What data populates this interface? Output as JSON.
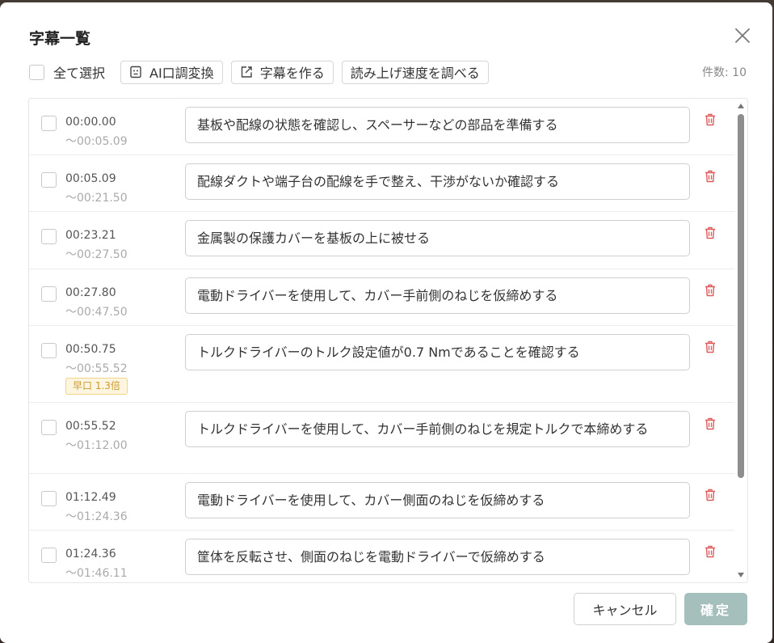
{
  "dialog": {
    "title": "字幕一覧",
    "select_all_label": "全て選択",
    "buttons": {
      "ai_tone": "AI口調変換",
      "make_subtitle": "字幕を作る",
      "check_speed": "読み上げ速度を調べる"
    },
    "count_text": "件数: 10",
    "cancel_label": "キャンセル",
    "confirm_label": "確定"
  },
  "colors": {
    "delete_icon": "#e05a5a",
    "confirm_bg": "#a5bfbc",
    "badge_text": "#c99a2e"
  },
  "rows": [
    {
      "start": "00:00.00",
      "end": "〜00:05.09",
      "text": "基板や配線の状態を確認し、スペーサーなどの部品を準備する",
      "badge": ""
    },
    {
      "start": "00:05.09",
      "end": "〜00:21.50",
      "text": "配線ダクトや端子台の配線を手で整え、干渉がないか確認する",
      "badge": ""
    },
    {
      "start": "00:23.21",
      "end": "〜00:27.50",
      "text": "金属製の保護カバーを基板の上に被せる",
      "badge": ""
    },
    {
      "start": "00:27.80",
      "end": "〜00:47.50",
      "text": "電動ドライバーを使用して、カバー手前側のねじを仮締めする",
      "badge": ""
    },
    {
      "start": "00:50.75",
      "end": "〜00:55.52",
      "text": "トルクドライバーのトルク設定値が0.7 Nmであることを確認する",
      "badge": "早口 1.3倍"
    },
    {
      "start": "00:55.52",
      "end": "〜01:12.00",
      "text": "トルクドライバーを使用して、カバー手前側のねじを規定トルクで本締めする",
      "badge": ""
    },
    {
      "start": "01:12.49",
      "end": "〜01:24.36",
      "text": "電動ドライバーを使用して、カバー側面のねじを仮締めする",
      "badge": ""
    },
    {
      "start": "01:24.36",
      "end": "〜01:46.11",
      "text": "筐体を反転させ、側面のねじを電動ドライバーで仮締めする",
      "badge": ""
    }
  ]
}
